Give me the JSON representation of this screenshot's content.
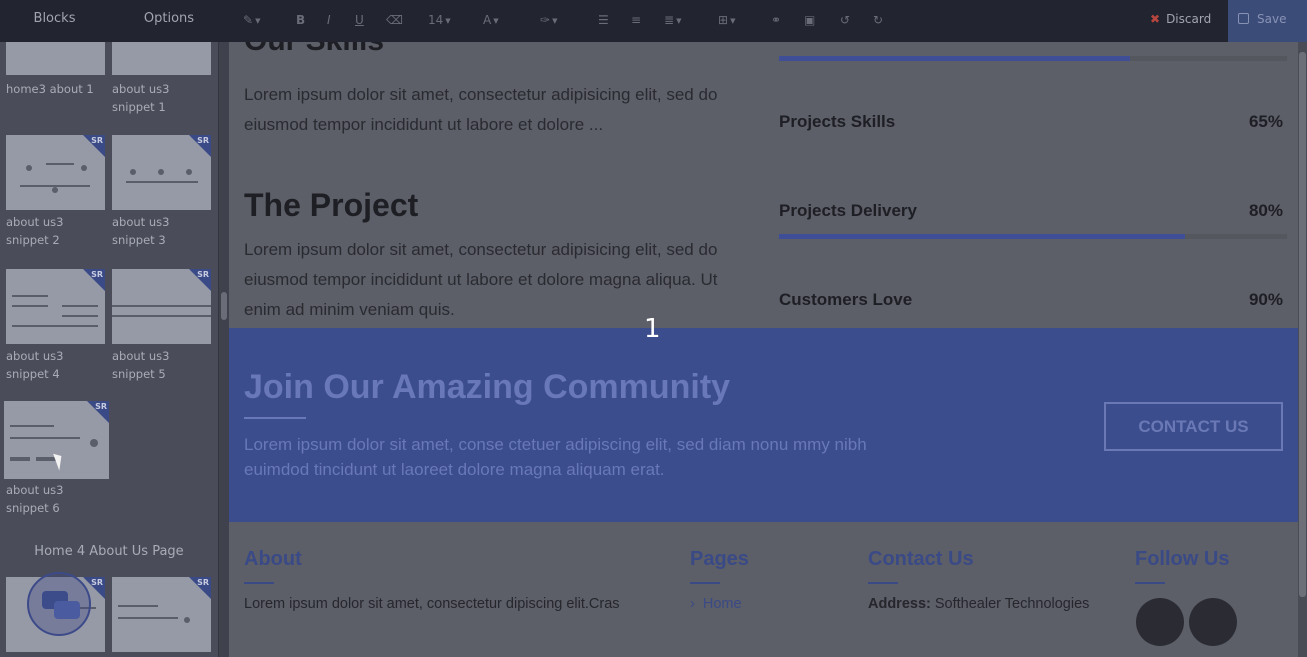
{
  "toolbar": {
    "tabs": [
      "Blocks",
      "Options"
    ],
    "tools": [
      {
        "icon": "pen-icon",
        "glyph": "✎",
        "caret": true
      },
      {
        "icon": "bold-icon",
        "glyph": "B",
        "caret": false
      },
      {
        "icon": "italic-icon",
        "glyph": "I",
        "caret": false
      },
      {
        "icon": "underline-icon",
        "glyph": "U",
        "caret": false
      },
      {
        "icon": "eraser-icon",
        "glyph": "⌫",
        "caret": false
      },
      {
        "icon": "font-size-icon",
        "glyph": "14",
        "caret": true
      },
      {
        "icon": "text-color-icon",
        "glyph": "A",
        "caret": true
      },
      {
        "icon": "highlight-icon",
        "glyph": "✑",
        "caret": true
      },
      {
        "icon": "unordered-list-icon",
        "glyph": "☰",
        "caret": false
      },
      {
        "icon": "ordered-list-icon",
        "glyph": "≡",
        "caret": false
      },
      {
        "icon": "align-icon",
        "glyph": "≣",
        "caret": true
      },
      {
        "icon": "table-icon",
        "glyph": "⊞",
        "caret": true
      },
      {
        "icon": "link-icon",
        "glyph": "⚭",
        "caret": false
      },
      {
        "icon": "image-icon",
        "glyph": "▣",
        "caret": false
      },
      {
        "icon": "undo-icon",
        "glyph": "↺",
        "caret": false
      },
      {
        "icon": "redo-icon",
        "glyph": "↻",
        "caret": false
      }
    ],
    "discard_label": "Discard",
    "save_label": "Save"
  },
  "sidebar": {
    "badge": "SR",
    "thumbnails": [
      {
        "label": "home3 about 1"
      },
      {
        "label": "about us3 snippet 1"
      },
      {
        "label": "about us3 snippet 2"
      },
      {
        "label": "about us3 snippet 3"
      },
      {
        "label": "about us3 snippet 4"
      },
      {
        "label": "about us3 snippet 5"
      },
      {
        "label": "about us3 snippet 6"
      }
    ],
    "section_title": "Home 4 About Us Page"
  },
  "content": {
    "skills_heading": "Our Skills",
    "skills_text": "Lorem ipsum dolor sit amet, consectetur adipisicing elit, sed do eiusmod tempor incididunt ut labore et dolore ...",
    "project_heading": "The Project",
    "project_text": "Lorem ipsum dolor sit amet, consectetur adipisicing elit, sed do eiusmod tempor incididunt ut labore et dolore magna aliqua. Ut enim ad minim veniam quis.",
    "skills": [
      {
        "label": "Projects Skills",
        "value": "65%",
        "level": 0.65
      },
      {
        "label": "Projects Delivery",
        "value": "80%",
        "level": 0.8
      },
      {
        "label": "Customers Love",
        "value": "90%",
        "level": 0.9
      }
    ],
    "step_number": "1"
  },
  "banner": {
    "title": "Join Our Amazing Community",
    "text": "Lorem ipsum dolor sit amet, conse ctetuer adipiscing elit, sed diam nonu mmy nibh euimdod tincidunt ut laoreet dolore magna aliquam erat.",
    "button_label": "CONTACT US"
  },
  "footer": {
    "about_title": "About",
    "about_text": "Lorem ipsum dolor sit amet, consectetur dipiscing elit.Cras",
    "pages_title": "Pages",
    "pages_first_link": "Home",
    "contact_title": "Contact Us",
    "address_label": "Address:",
    "address_value": "Softhealer Technologies",
    "follow_title": "Follow Us"
  },
  "colors": {
    "accent": "#3c4d8e",
    "toolbar_bg": "#222430",
    "sidebar_bg": "#4a4d59",
    "discard": "#b7463f"
  }
}
